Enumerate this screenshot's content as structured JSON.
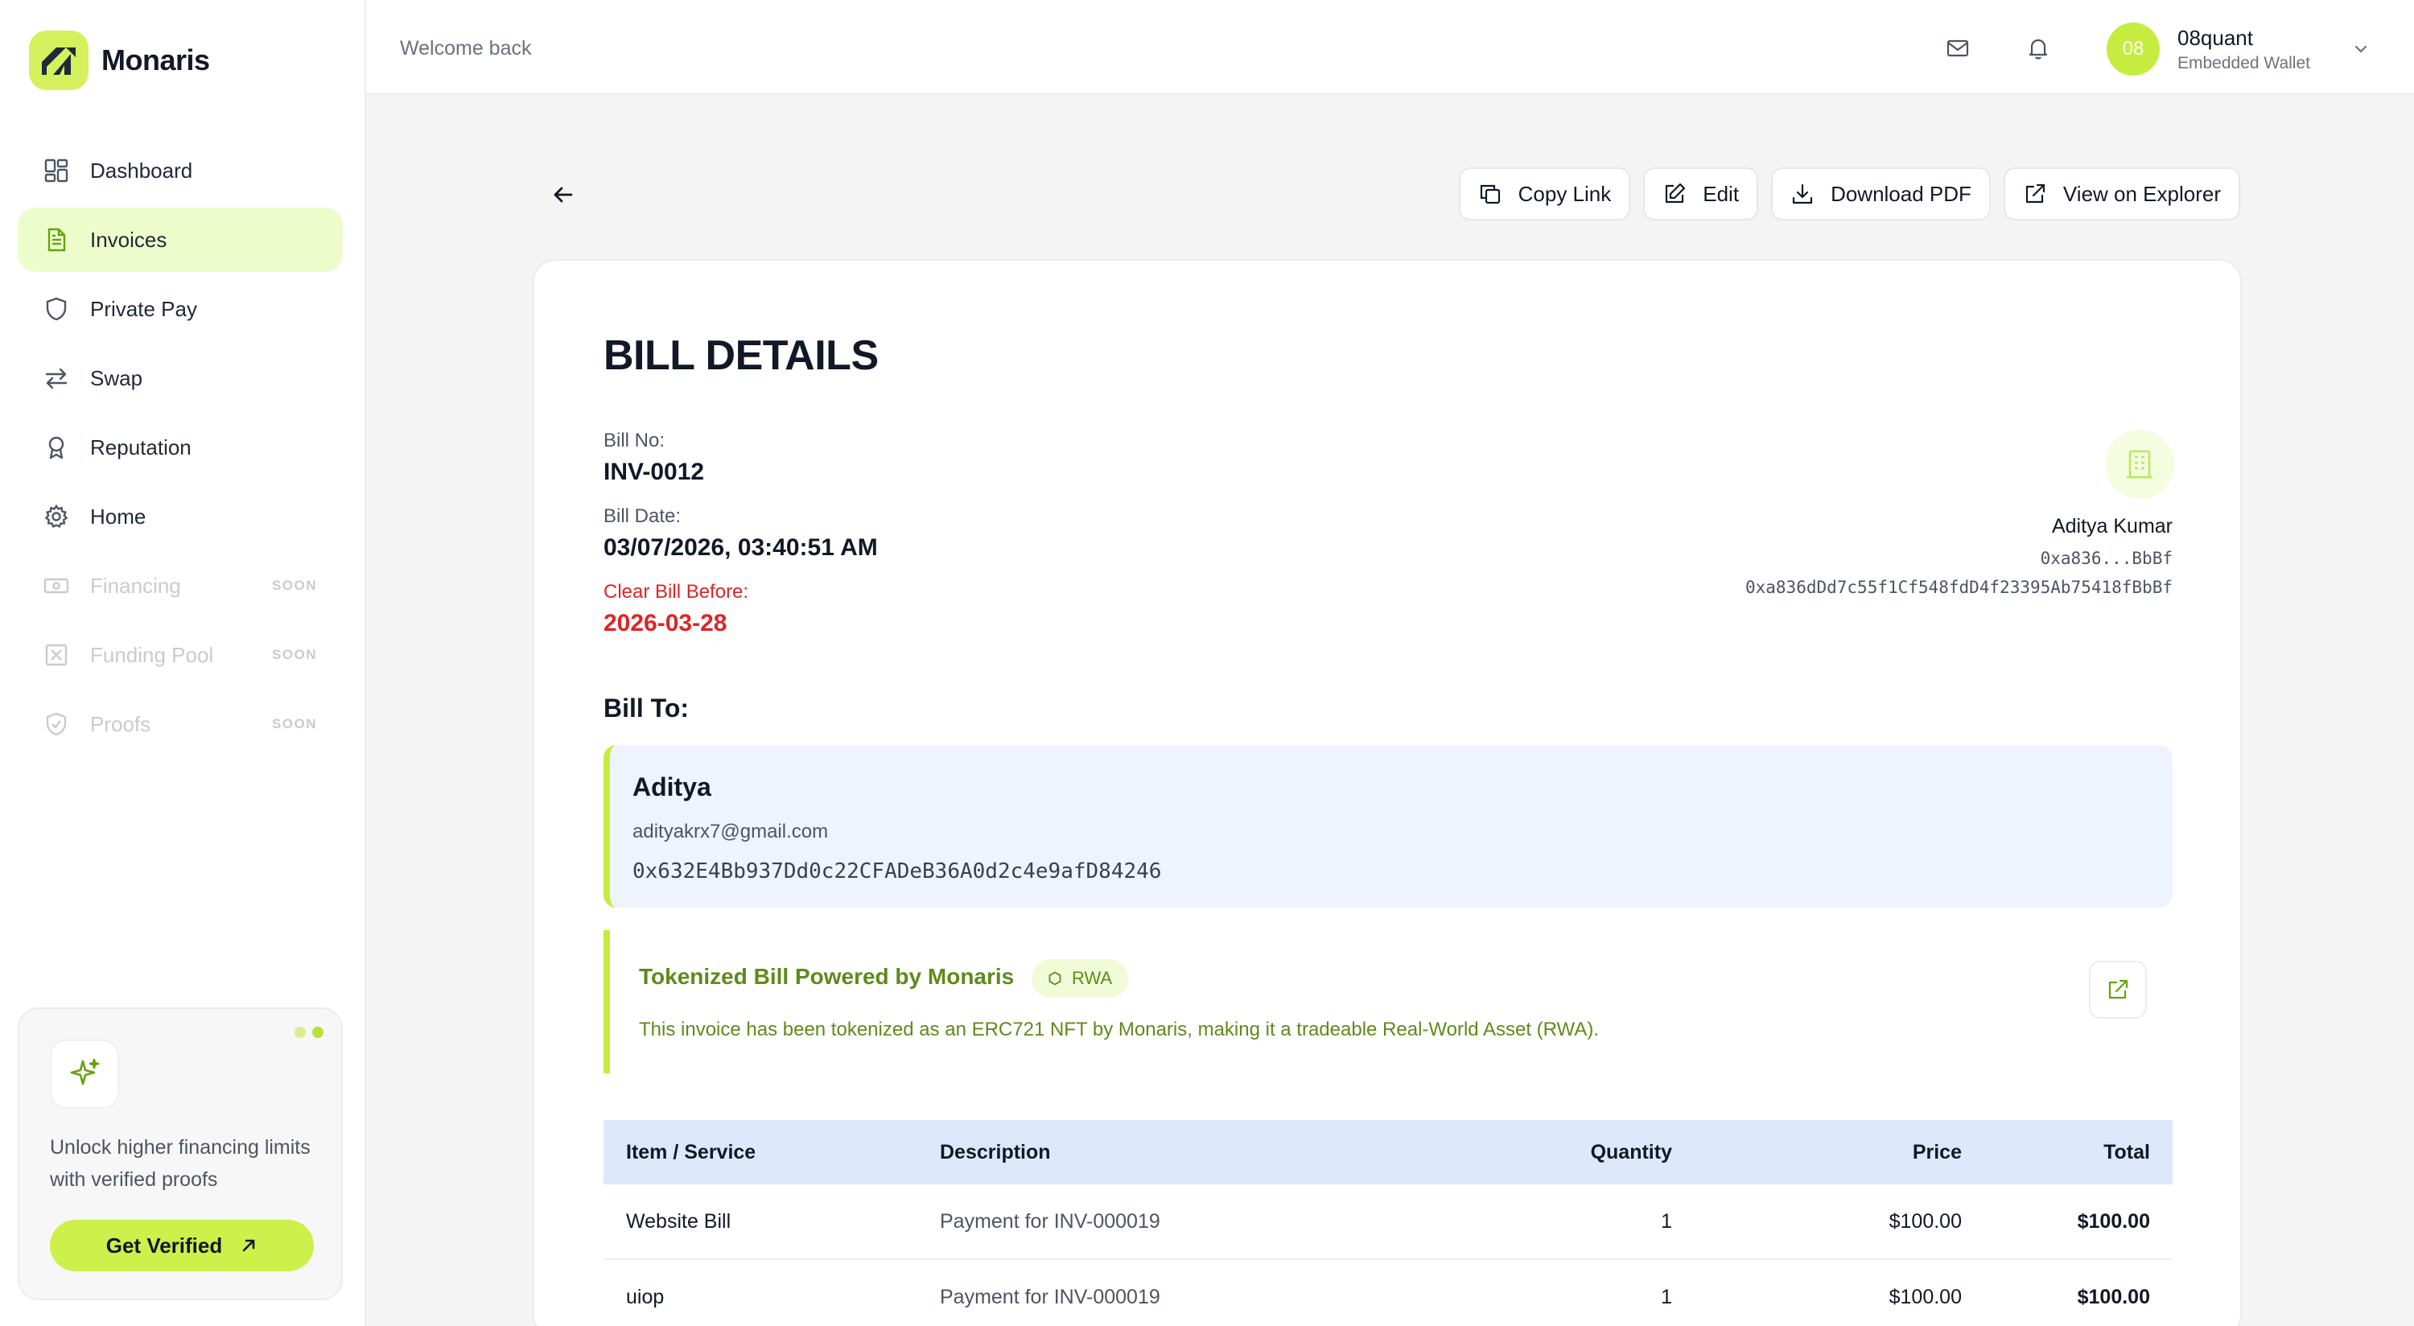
{
  "brand": {
    "name": "Monaris",
    "accent": "#c5ec3f"
  },
  "sidebar": {
    "items": [
      {
        "label": "Dashboard",
        "icon": "dashboard-icon",
        "state": "normal"
      },
      {
        "label": "Invoices",
        "icon": "document-icon",
        "state": "active"
      },
      {
        "label": "Private Pay",
        "icon": "shield-icon",
        "state": "normal"
      },
      {
        "label": "Swap",
        "icon": "swap-arrows-icon",
        "state": "normal"
      },
      {
        "label": "Reputation",
        "icon": "award-icon",
        "state": "normal"
      },
      {
        "label": "Home",
        "icon": "gear-icon",
        "state": "normal"
      },
      {
        "label": "Financing",
        "icon": "banknote-icon",
        "state": "disabled",
        "badge": "SOON"
      },
      {
        "label": "Funding Pool",
        "icon": "x-box-icon",
        "state": "disabled",
        "badge": "SOON"
      },
      {
        "label": "Proofs",
        "icon": "shield-check-icon",
        "state": "disabled",
        "badge": "SOON"
      }
    ],
    "promo": {
      "text": "Unlock higher financing limits with verified proofs",
      "button": "Get Verified"
    }
  },
  "header": {
    "welcome": "Welcome back",
    "user": {
      "initials": "08",
      "name": "08quant",
      "subtitle": "Embedded Wallet"
    }
  },
  "toolbar": {
    "copy_link": "Copy Link",
    "edit": "Edit",
    "download_pdf": "Download PDF",
    "view_explorer": "View on Explorer"
  },
  "bill": {
    "title": "BILL DETAILS",
    "bill_no_label": "Bill No:",
    "bill_no": "INV-0012",
    "bill_date_label": "Bill Date:",
    "bill_date": "03/07/2026, 03:40:51 AM",
    "due_label": "Clear Bill Before:",
    "due_date": "2026-03-28",
    "issuer": {
      "name": "Aditya Kumar",
      "address_short": "0xa836...BbBf",
      "address_full": "0xa836dDd7c55f1Cf548fdD4f23395Ab75418fBbBf"
    },
    "bill_to_label": "Bill To:",
    "recipient": {
      "name": "Aditya",
      "email": "adityakrx7@gmail.com",
      "address": "0x632E4Bb937Dd0c22CFADeB36A0d2c4e9afD84246"
    },
    "tokenized": {
      "title": "Tokenized Bill Powered by Monaris",
      "badge": "RWA",
      "description": "This invoice has been tokenized as an ERC721 NFT by Monaris, making it a tradeable Real-World Asset (RWA)."
    },
    "table": {
      "headers": [
        "Item / Service",
        "Description",
        "Quantity",
        "Price",
        "Total"
      ],
      "rows": [
        [
          "Website Bill",
          "Payment for INV-000019",
          "1",
          "$100.00",
          "$100.00"
        ],
        [
          "uiop",
          "Payment for INV-000019",
          "1",
          "$100.00",
          "$100.00"
        ]
      ]
    }
  }
}
